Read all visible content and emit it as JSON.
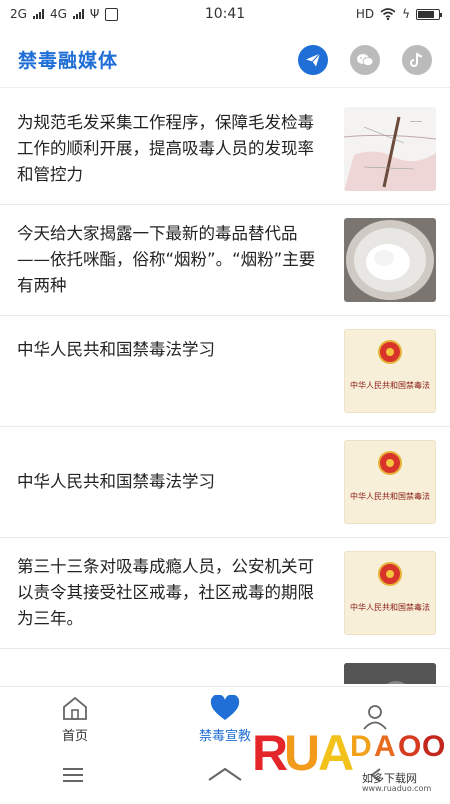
{
  "status": {
    "network_left": "2G",
    "network_right": "4G",
    "time": "10:41",
    "hd": "HD"
  },
  "header": {
    "title": "禁毒融媒体"
  },
  "news": [
    {
      "text": "为规范毛发采集工作程序，保障毛发检毒工作的顺利开展，提高吸毒人员的发现率和管控力",
      "thumb": "hair-diagram"
    },
    {
      "text": "今天给大家揭露一下最新的毒品替代品——依托咪酯，俗称“烟粉”。“烟粉”主要有两种",
      "thumb": "powder-photo"
    },
    {
      "text": "中华人民共和国禁毒法学习",
      "thumb": "law-cover"
    },
    {
      "text": "中华人民共和国禁毒法学习",
      "thumb": "law-cover"
    },
    {
      "text": "第三十三条对吸毒成瘾人员，公安机关可以责令其接受社区戒毒，社区戒毒的期限为三年。",
      "thumb": "law-cover"
    },
    {
      "text": "",
      "thumb": "portrait"
    }
  ],
  "law_cover_title": "中华人民共和国禁毒法",
  "bottom_nav": {
    "home": "首页",
    "propaganda": "禁毒宣教",
    "mine": ""
  },
  "watermark": {
    "brand": "RUANDAO",
    "sub": "如多下载网",
    "url": "www.ruaduo.com"
  },
  "colors": {
    "accent": "#1f6fd6"
  }
}
